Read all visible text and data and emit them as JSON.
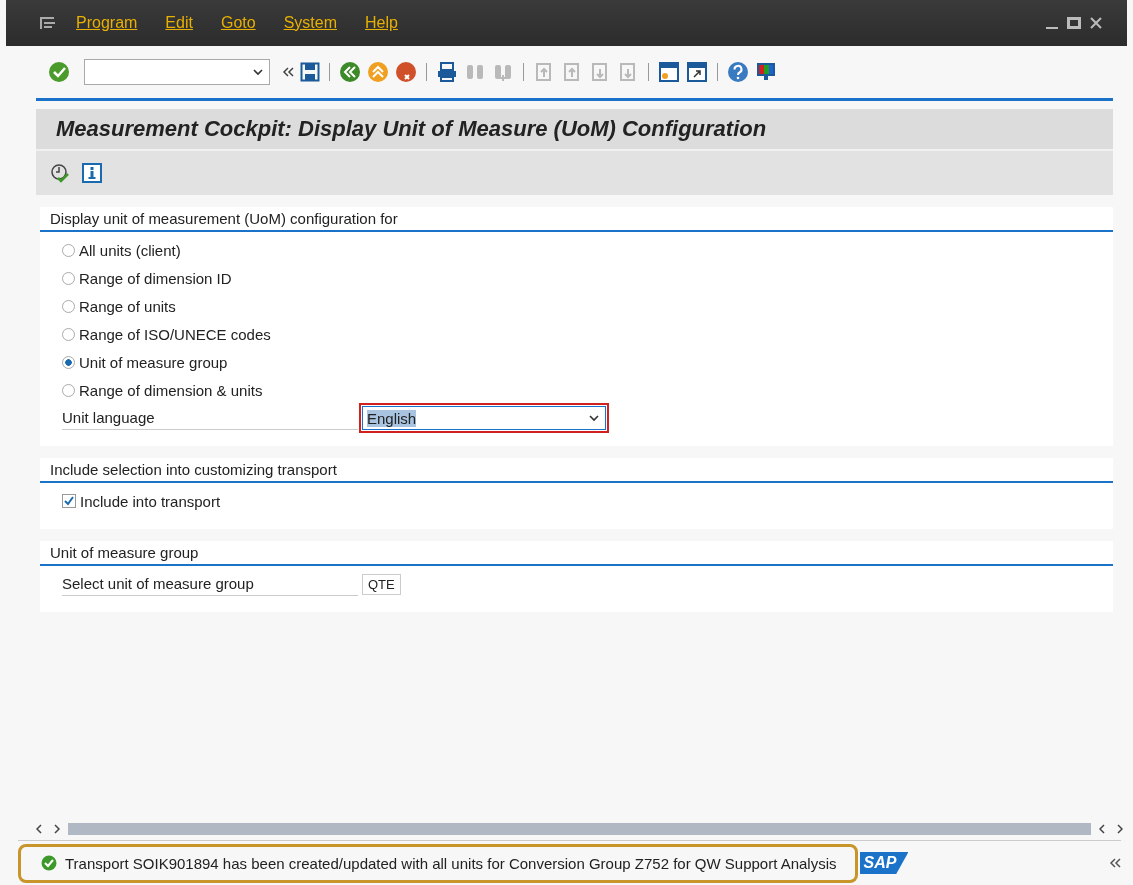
{
  "menu_bar": {
    "items": [
      "Program",
      "Edit",
      "Goto",
      "System",
      "Help"
    ]
  },
  "toolbar": {
    "buttons": [
      {
        "kind": "back",
        "disabled": false
      },
      {
        "kind": "exit",
        "disabled": false
      },
      {
        "kind": "cancel",
        "disabled": false
      },
      {
        "kind": "sep"
      },
      {
        "kind": "print",
        "disabled": false
      },
      {
        "kind": "find",
        "disabled": true
      },
      {
        "kind": "find-next",
        "disabled": true
      },
      {
        "kind": "sep"
      },
      {
        "kind": "first-page",
        "disabled": true
      },
      {
        "kind": "prev-page",
        "disabled": true
      },
      {
        "kind": "next-page",
        "disabled": true
      },
      {
        "kind": "last-page",
        "disabled": true
      },
      {
        "kind": "sep"
      },
      {
        "kind": "new-session",
        "disabled": false
      },
      {
        "kind": "shortcut",
        "disabled": false
      },
      {
        "kind": "sep"
      },
      {
        "kind": "help",
        "disabled": false
      },
      {
        "kind": "layout",
        "disabled": false
      }
    ]
  },
  "title": "Measurement Cockpit: Display Unit of Measure (UoM) Configuration",
  "groups": [
    {
      "title": "Display unit of measurement (UoM) configuration for",
      "rows": [
        {
          "kind": "radio",
          "label": "All units (client)",
          "selected": false
        },
        {
          "kind": "radio",
          "label": "Range of dimension ID",
          "selected": false
        },
        {
          "kind": "radio",
          "label": "Range of units",
          "selected": false
        },
        {
          "kind": "radio",
          "label": "Range of ISO/UNECE codes",
          "selected": false
        },
        {
          "kind": "radio",
          "label": "Unit of measure group",
          "selected": true
        },
        {
          "kind": "radio",
          "label": "Range of dimension & units",
          "selected": false
        },
        {
          "kind": "dropdown",
          "label": "Unit language",
          "value": "English"
        }
      ]
    },
    {
      "title": "Include selection into customizing transport",
      "rows": [
        {
          "kind": "checkbox",
          "label": "Include into transport",
          "checked": true
        }
      ]
    },
    {
      "title": "Unit of measure group",
      "rows": [
        {
          "kind": "input",
          "label": "Select unit of measure group",
          "value": "QTE"
        }
      ]
    }
  ],
  "status_bar": {
    "message": "Transport SOIK901894 has been created/updated with all units for Conversion Group Z752 for QW Support Analysis",
    "highlighted": true,
    "logo": "SAP"
  }
}
